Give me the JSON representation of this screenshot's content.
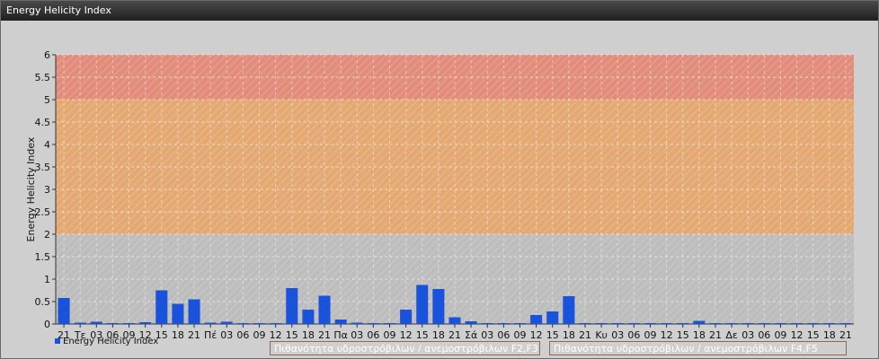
{
  "window": {
    "title": "Energy Helicity Index"
  },
  "chart_data": {
    "type": "bar",
    "ylabel": "Energy Helicity Index",
    "xlabel": "",
    "ylim": [
      0,
      6
    ],
    "yticks": [
      "0",
      "0.5",
      "1",
      "1.5",
      "2",
      "2.5",
      "3",
      "3.5",
      "4",
      "4.5",
      "5",
      "5.5",
      "6"
    ],
    "grid": true,
    "legend_position": "bottom-left",
    "categories": [
      "21",
      "Τε",
      "03",
      "06",
      "09",
      "12",
      "15",
      "18",
      "21",
      "Πέ",
      "03",
      "06",
      "09",
      "12",
      "15",
      "18",
      "21",
      "Πα",
      "03",
      "06",
      "09",
      "12",
      "15",
      "18",
      "21",
      "Σά",
      "03",
      "06",
      "09",
      "12",
      "15",
      "18",
      "21",
      "Κυ",
      "03",
      "06",
      "09",
      "12",
      "15",
      "18",
      "21",
      "Δε",
      "03",
      "06",
      "09",
      "12",
      "15",
      "18",
      "21"
    ],
    "series": [
      {
        "name": "Energy Helicity Index",
        "color": "#1a53db",
        "values": [
          0.58,
          0.03,
          0.05,
          0.02,
          0.02,
          0.04,
          0.75,
          0.45,
          0.55,
          0.03,
          0.05,
          0.02,
          0.02,
          0.02,
          0.8,
          0.32,
          0.63,
          0.1,
          0.03,
          0.02,
          0.02,
          0.32,
          0.87,
          0.78,
          0.15,
          0.06,
          0.02,
          0.02,
          0.02,
          0.2,
          0.28,
          0.62,
          0.02,
          0.02,
          0.02,
          0.02,
          0.02,
          0.02,
          0.02,
          0.07,
          0.02,
          0.02,
          0.02,
          0.02,
          0.02,
          0.02,
          0.02,
          0.02,
          0.02
        ]
      }
    ],
    "bands": [
      {
        "from": 2,
        "to": 5,
        "label": "Πιθανότητα υδροστρόβιλων / ανεμοστρόβιλων F2,F3",
        "color": "#e8a66a"
      },
      {
        "from": 5,
        "to": 6,
        "label": "Πιθανότητα υδροστρόβιλων / ανεμοστρόβιλων F4,F5",
        "color": "#e58773"
      }
    ]
  }
}
